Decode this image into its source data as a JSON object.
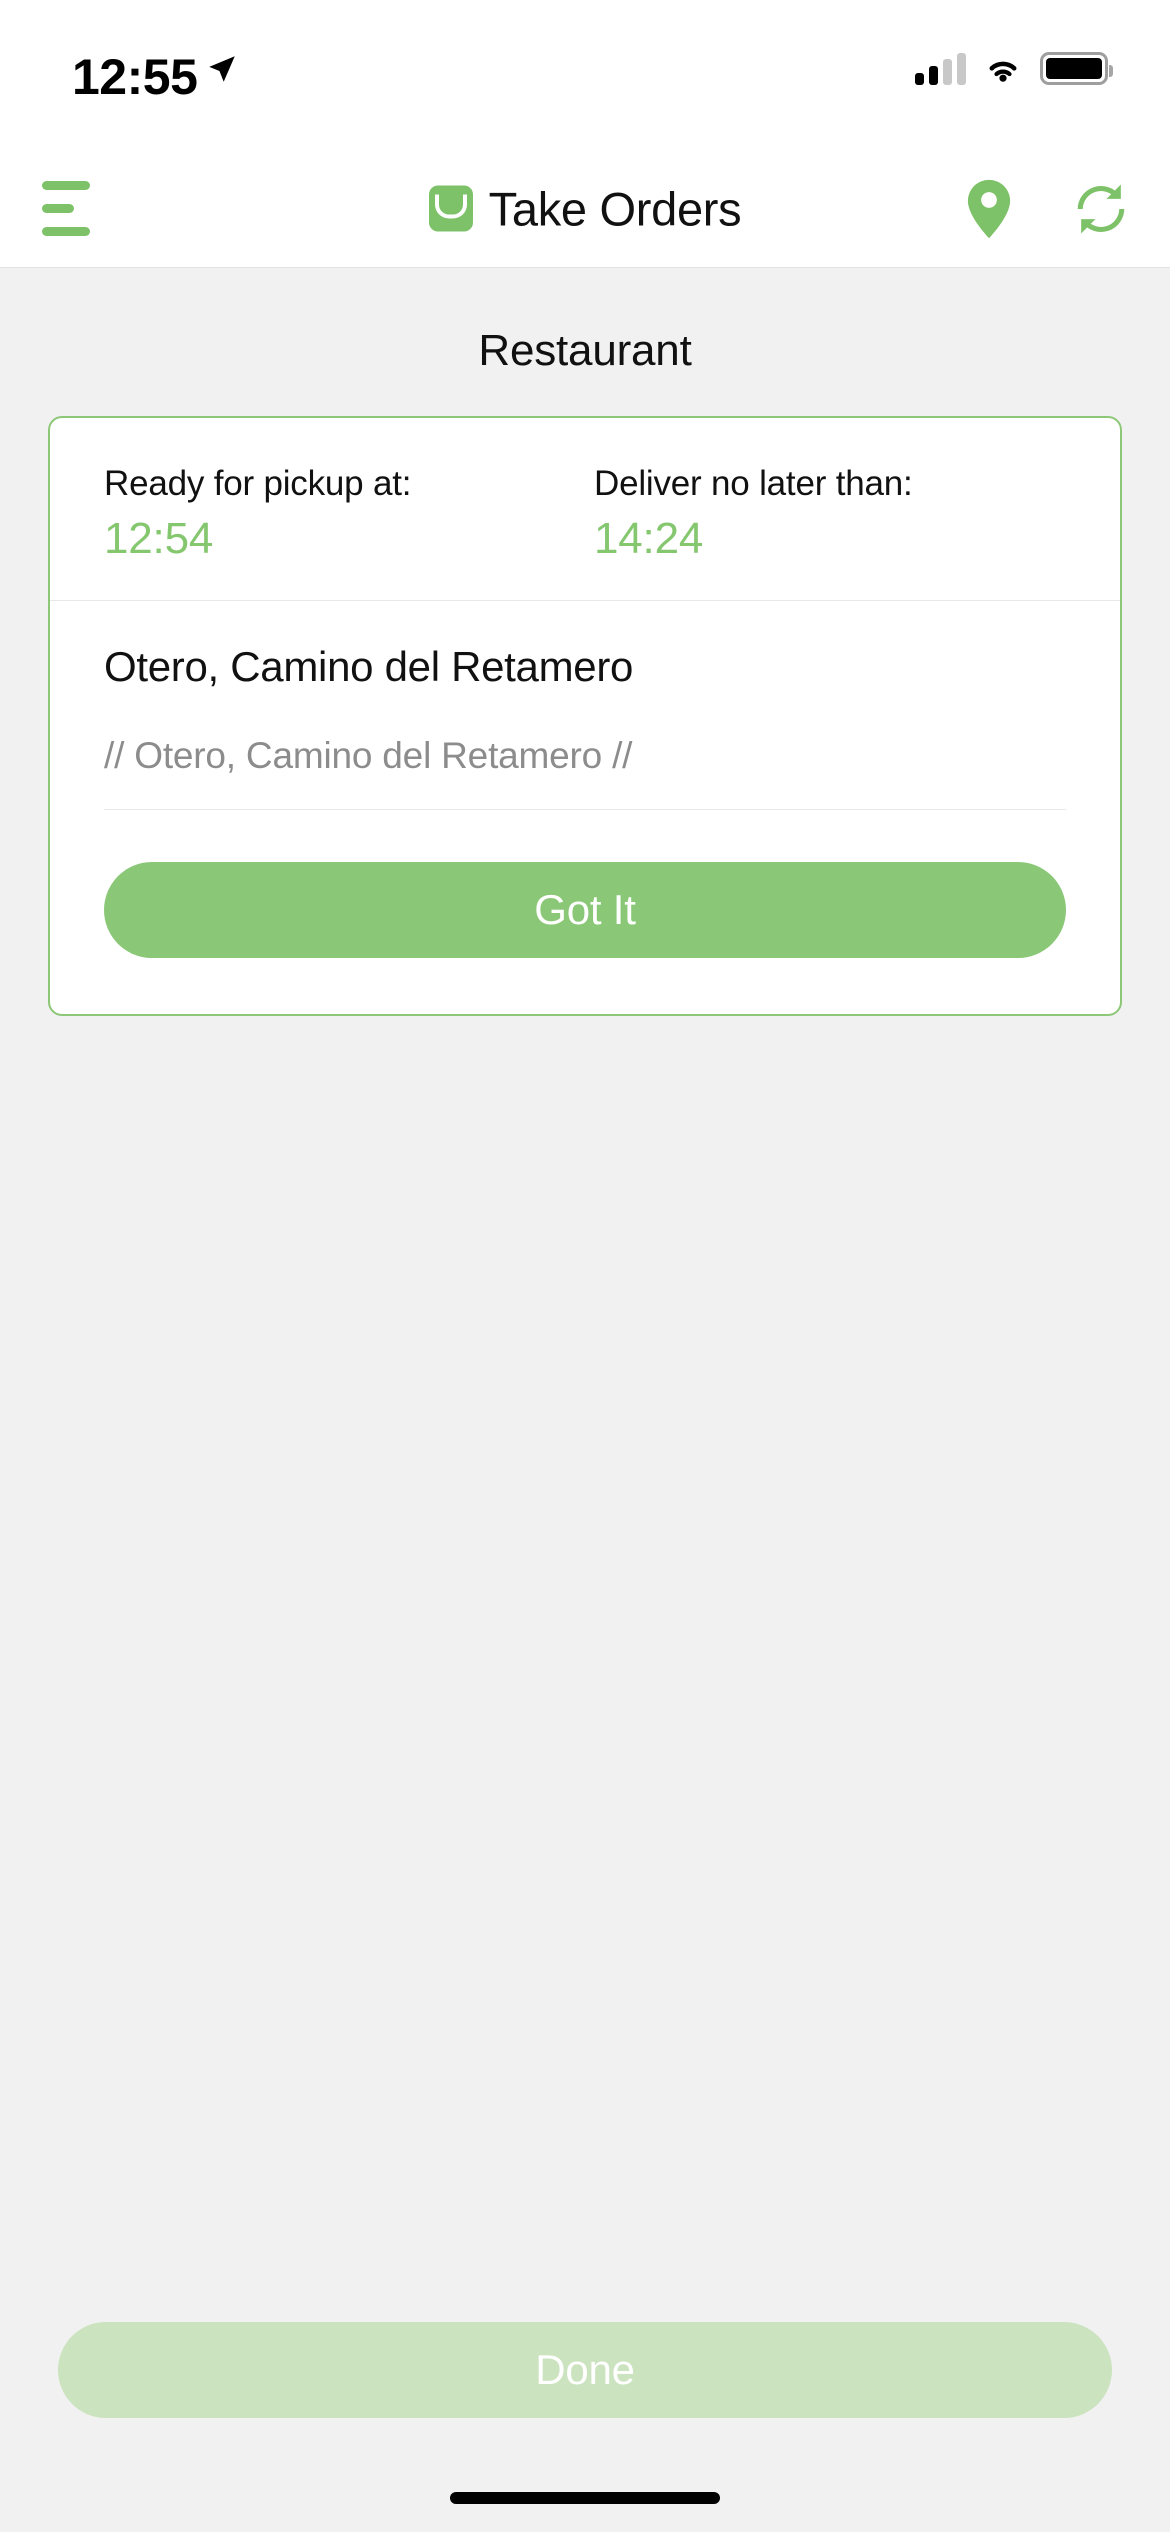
{
  "status_bar": {
    "time": "12:55",
    "location_arrow_icon": "location-arrow-icon",
    "cellular_icon": "cellular-bars-icon",
    "wifi_icon": "wifi-icon",
    "battery_icon": "battery-full-icon"
  },
  "nav_bar": {
    "menu_icon": "hamburger-menu-icon",
    "brand_icon": "shopping-bag-logo-icon",
    "title": "Take Orders",
    "map_pin_icon": "map-pin-icon",
    "refresh_icon": "refresh-sync-icon"
  },
  "main": {
    "section_title": "Restaurant",
    "card": {
      "pickup_label": "Ready for pickup at:",
      "pickup_time": "12:54",
      "deliver_label": "Deliver no later than:",
      "deliver_time": "14:24",
      "address_primary": "Otero, Camino del Retamero",
      "address_secondary": "// Otero, Camino del Retamero //",
      "confirm_label": "Got It"
    }
  },
  "footer": {
    "done_label": "Done",
    "done_disabled": true
  },
  "colors": {
    "accent_green": "#7dc268",
    "card_border_green": "#8dc878",
    "time_green": "#85c76f",
    "button_green": "#8ac878",
    "disabled_green": "#cbe3bf",
    "page_background": "#f1f1f1",
    "card_background": "#ffffff",
    "text_primary": "#111111",
    "text_muted": "#8c8c8c"
  }
}
